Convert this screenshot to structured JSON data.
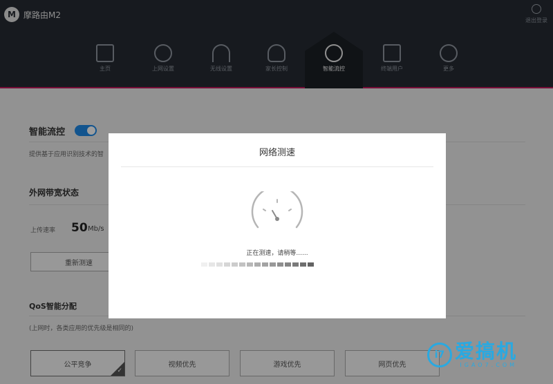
{
  "header": {
    "brand_logo": "M",
    "brand_name": "摩路由M2",
    "logout_label": "退出登录",
    "nav": [
      {
        "label": "主页",
        "icon": "home-icon"
      },
      {
        "label": "上网设置",
        "icon": "globe-icon"
      },
      {
        "label": "无线设置",
        "icon": "wifi-icon"
      },
      {
        "label": "家长控制",
        "icon": "person-icon"
      },
      {
        "label": "智能流控",
        "icon": "pulse-icon",
        "active": true
      },
      {
        "label": "终端用户",
        "icon": "devices-icon"
      },
      {
        "label": "更多",
        "icon": "more-icon"
      }
    ]
  },
  "page": {
    "title": "智能流控",
    "toggle_on": true,
    "description": "提供基于应用识别技术的智",
    "bandwidth_title": "外网带宽状态",
    "upload_label": "上传速率",
    "upload_value": "50",
    "upload_unit": "Mb/s",
    "retest_button": "重新测速",
    "qos_title": "QoS智能分配",
    "qos_desc": "(上网时，各类应用的优先级是相同的)",
    "qos_options": [
      "公平竞争",
      "视频优先",
      "游戏优先",
      "网页优先"
    ],
    "qos_selected": "公平竞争"
  },
  "modal": {
    "title": "网络测速",
    "status": "正在测速，请稍等......",
    "progress_colors": [
      "#f0f0f0",
      "#e6e6e6",
      "#e0e0e0",
      "#d6d6d6",
      "#cccccc",
      "#c2c2c2",
      "#b8b8b8",
      "#adadad",
      "#a3a3a3",
      "#999999",
      "#8f8f8f",
      "#858585",
      "#7a7a7a",
      "#6e6e6e",
      "#636363"
    ]
  },
  "watermark": {
    "logo": "i7",
    "main": "爱搞机",
    "sub": "IGAO7.COM"
  }
}
